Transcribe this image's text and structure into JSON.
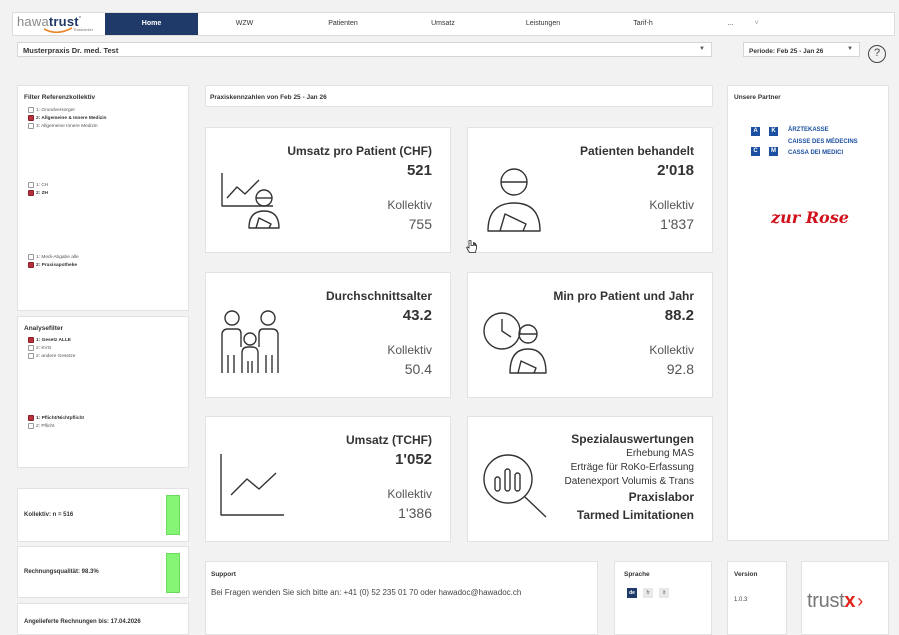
{
  "nav": {
    "logo_main": "hawa",
    "logo_bold": "trust",
    "logo_sub": "Trustcenter",
    "items": [
      {
        "label": "Home",
        "active": true
      },
      {
        "label": "WZW",
        "active": false
      },
      {
        "label": "Patienten",
        "active": false
      },
      {
        "label": "Umsatz",
        "active": false
      },
      {
        "label": "Leistungen",
        "active": false
      },
      {
        "label": "Tarif-h",
        "active": false
      },
      {
        "label": "...",
        "active": false
      }
    ],
    "more_chevron": "˅"
  },
  "practice_select": {
    "value": "Musterpraxis Dr. med. Test"
  },
  "period_select": {
    "value": "Periode: Feb 25 - Jan 26"
  },
  "help_label": "?",
  "filter_ref": {
    "title": "Filter Referenzkollektiv",
    "group1": [
      {
        "label": "1: Grundversorger",
        "checked": false
      },
      {
        "label": "2: Allgemeine & Innere Medizin",
        "checked": true
      },
      {
        "label": "3: Allgemeine Innere Medizin",
        "checked": false
      }
    ],
    "group2": [
      {
        "label": "1: CH",
        "checked": false
      },
      {
        "label": "2: ZH",
        "checked": true
      }
    ],
    "group3": [
      {
        "label": "1: Medi-Abgabe alle",
        "checked": false
      },
      {
        "label": "2: Praxisapotheke",
        "checked": true
      }
    ]
  },
  "analyse": {
    "title": "Analysefilter",
    "group1": [
      {
        "label": "1: Gesetz ALLE",
        "checked": true
      },
      {
        "label": "2: KVG",
        "checked": false
      },
      {
        "label": "2: andere Gesetze",
        "checked": false
      }
    ],
    "group2": [
      {
        "label": "1: Pflicht/Nichtpflicht",
        "checked": true
      },
      {
        "label": "2: Pflicht",
        "checked": false
      }
    ]
  },
  "kollektiv": {
    "label": "Kollektiv: n = 516"
  },
  "rechnungsqualitaet": {
    "label": "Rechnungsqualität: 98.3%"
  },
  "angeliefert": {
    "label": "Angelieferte Rechnungen bis: 17.04.2026"
  },
  "praxis_header": "Praxiskennzahlen von Feb 25 - Jan 26",
  "kpis": {
    "umsatz_patient": {
      "title": "Umsatz pro Patient (CHF)",
      "value": "521",
      "kollektiv_label": "Kollektiv",
      "kollektiv_value": "755"
    },
    "patienten": {
      "title": "Patienten behandelt",
      "value": "2'018",
      "kollektiv_label": "Kollektiv",
      "kollektiv_value": "1'837"
    },
    "alter": {
      "title": "Durchschnittsalter",
      "value": "43.2",
      "kollektiv_label": "Kollektiv",
      "kollektiv_value": "50.4"
    },
    "min_patient": {
      "title": "Min pro Patient und Jahr",
      "value": "88.2",
      "kollektiv_label": "Kollektiv",
      "kollektiv_value": "92.8"
    },
    "umsatz_tchf": {
      "title": "Umsatz (TCHF)",
      "value": "1'052",
      "kollektiv_label": "Kollektiv",
      "kollektiv_value": "1'386"
    }
  },
  "spezial": {
    "title": "Spezialauswertungen",
    "lines": [
      "Erhebung MAS",
      "Erträge für RoKo-Erfassung",
      "Datenexport Volumis & Trans"
    ],
    "bold_lines": [
      "Praxislabor",
      "Tarmed Limitationen"
    ]
  },
  "partner": {
    "title": "Unsere Partner",
    "akc_letters": [
      "A",
      "K",
      "C",
      "M"
    ],
    "akc_lines": [
      "ÄRZTEKASSE",
      "CAISSE DES MÉDECINS",
      "CASSA DEI MEDICI"
    ],
    "zurrose": "zur Rose"
  },
  "support": {
    "title": "Support",
    "text": "Bei Fragen wenden Sie sich bitte an: +41 (0) 52 235 01 70 oder hawadoc@hawadoc.ch"
  },
  "sprache": {
    "title": "Sprache",
    "options": [
      {
        "label": "de",
        "active": true
      },
      {
        "label": "fr",
        "active": false
      },
      {
        "label": "it",
        "active": false
      }
    ]
  },
  "version": {
    "title": "Version",
    "value": "1.0.3"
  },
  "trustx": {
    "main": "trust",
    "accent": "x",
    "chevron": "›"
  },
  "colors": {
    "brand": "#1f3a68",
    "checked": "#b5303a",
    "green": "#86f575",
    "trustx_red": "#e2231a"
  }
}
